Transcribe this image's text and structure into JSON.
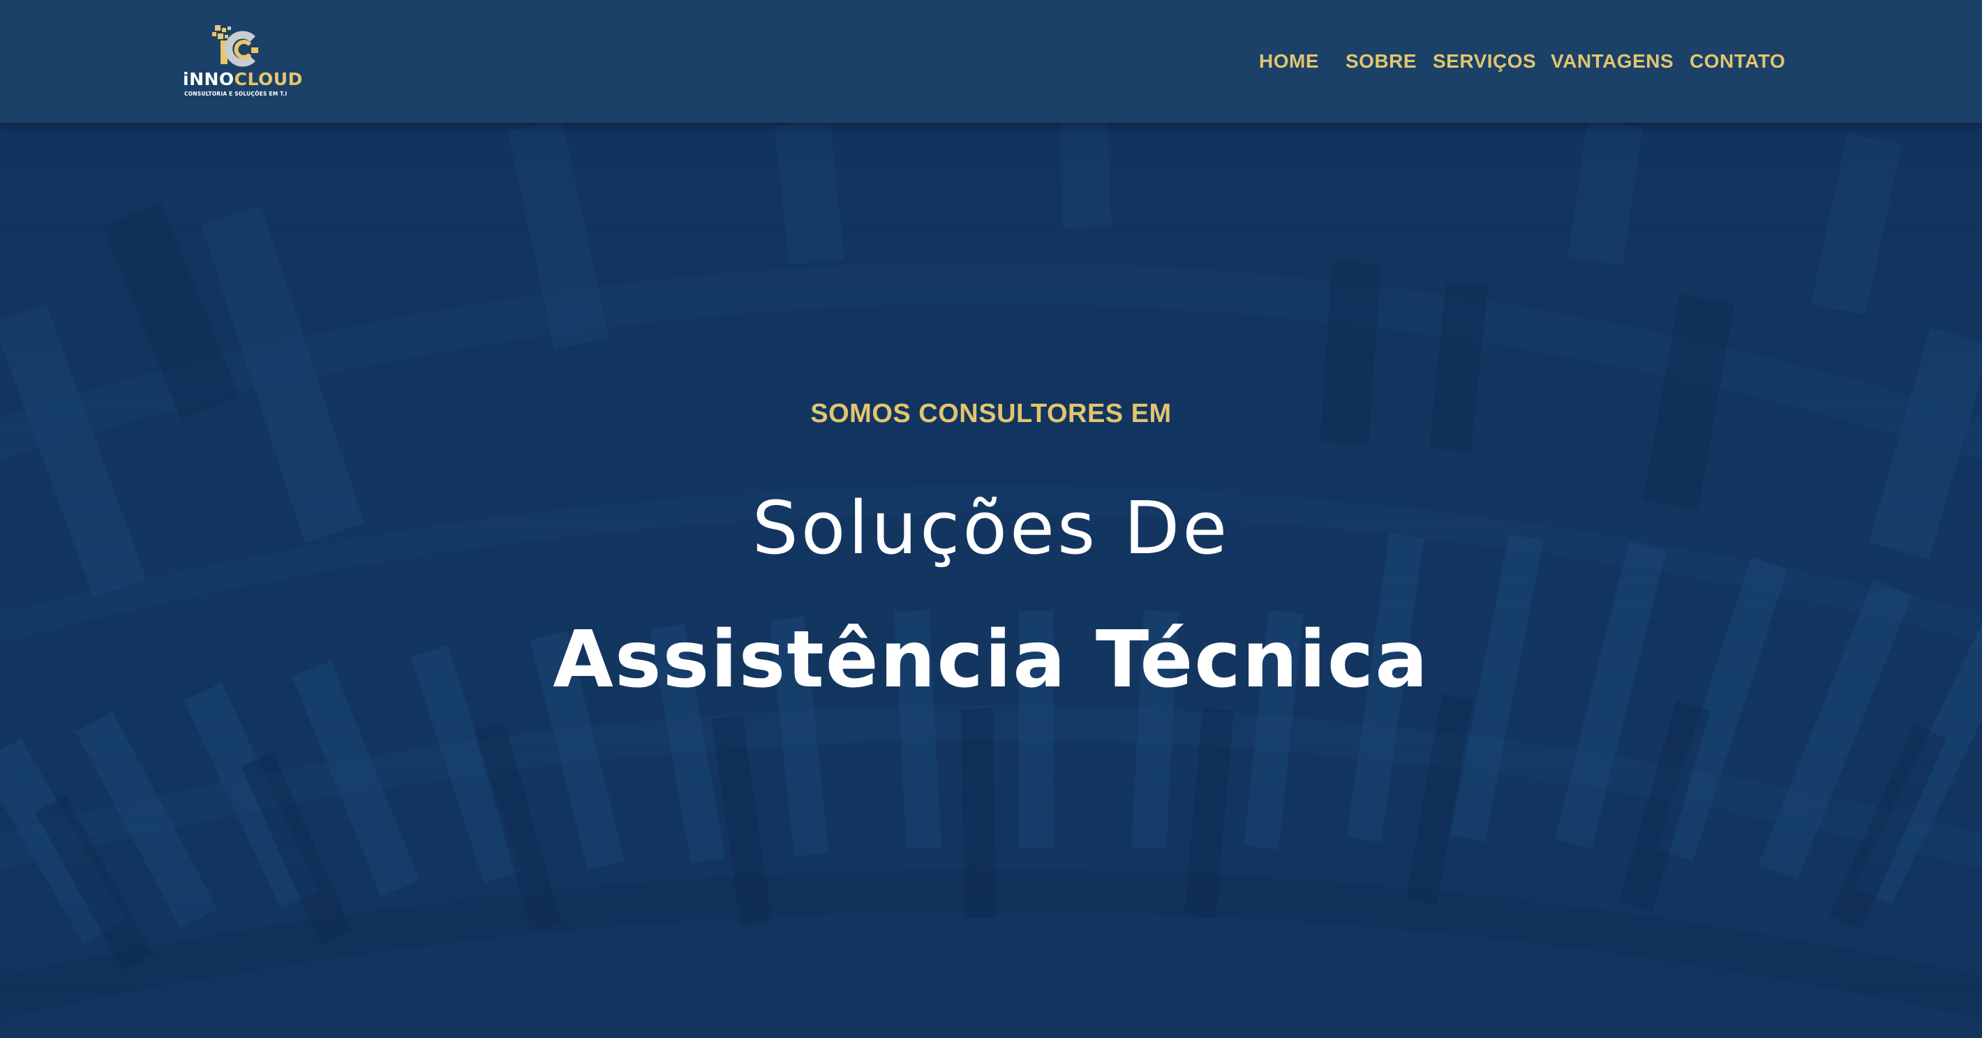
{
  "colors": {
    "header_bg": "#1b4168",
    "hero_bg": "#133661",
    "accent_gold": "#e3c56f",
    "text_white": "#ffffff"
  },
  "logo": {
    "name_part1": "iNNO",
    "name_part2": "CLOUD",
    "tagline": "CONSULTORIA E SOLUÇÕES EM T.I",
    "icon": "innocloud-logo-icon"
  },
  "nav": {
    "items": [
      {
        "label": "HOME"
      },
      {
        "label": "SOBRE"
      },
      {
        "label": "SERVIÇOS"
      },
      {
        "label": "VANTAGENS"
      },
      {
        "label": "CONTATO"
      }
    ]
  },
  "hero": {
    "eyebrow": "SOMOS CONSULTORES EM",
    "line1": "Soluções De",
    "line2": "Assistência Técnica"
  }
}
